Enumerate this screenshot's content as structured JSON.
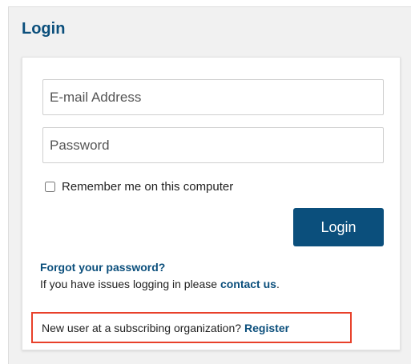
{
  "panel": {
    "title": "Login"
  },
  "form": {
    "email_placeholder": "E-mail Address",
    "email_value": "",
    "password_placeholder": "Password",
    "password_value": "",
    "remember_label": "Remember me on this computer",
    "remember_checked": false,
    "login_label": "Login"
  },
  "help": {
    "forgot_label": "Forgot your password?",
    "issues_prefix": "If you have issues logging in please",
    "contact_label": "contact us",
    "issues_suffix": "."
  },
  "register": {
    "prompt": "New user at a subscribing organization?",
    "link_label": "Register",
    "highlight_color": "#e8402a"
  },
  "colors": {
    "brand": "#0b4f7c",
    "panel_bg": "#f1f1f1"
  }
}
